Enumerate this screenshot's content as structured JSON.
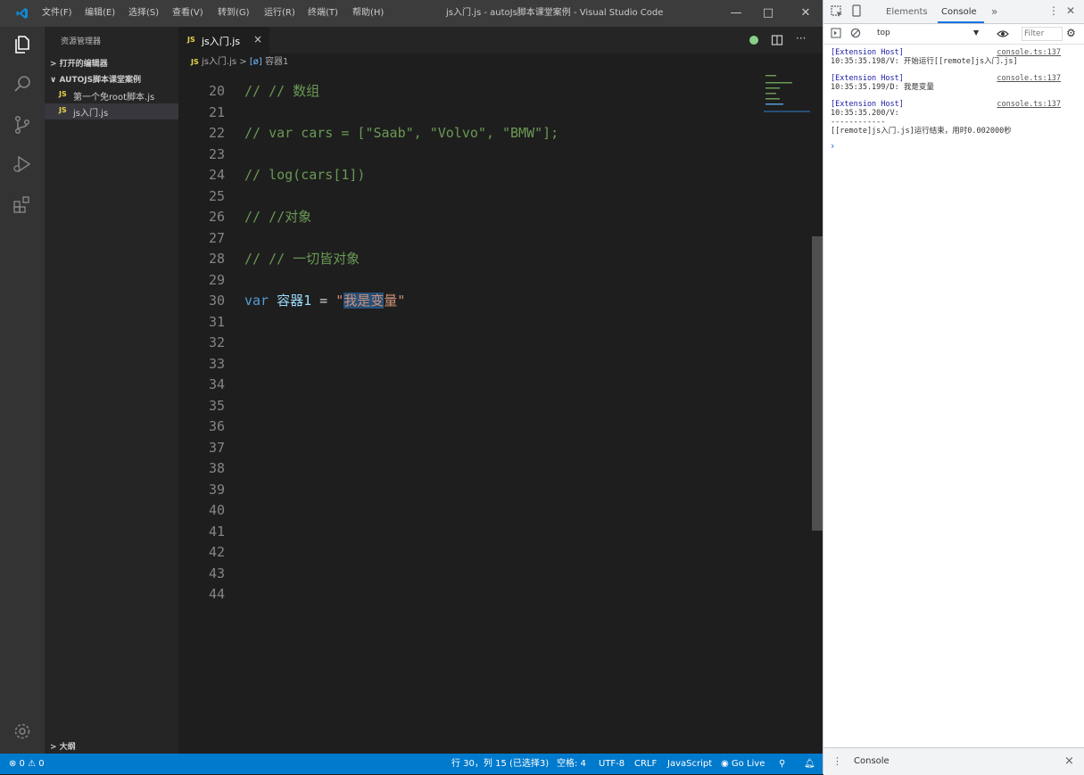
{
  "window": {
    "title": "js入门.js - autoJs脚本课堂案例 - Visual Studio Code",
    "menu": [
      "文件(F)",
      "编辑(E)",
      "选择(S)",
      "查看(V)",
      "转到(G)",
      "运行(R)",
      "终端(T)",
      "帮助(H)"
    ],
    "controls": {
      "minimize": "—",
      "maximize": "□",
      "close": "✕"
    }
  },
  "sidebar": {
    "title": "资源管理器",
    "open_editors": "> 打开的编辑器",
    "folder": "∨ AUTOJS脚本课堂案例",
    "files": [
      {
        "icon": "JS",
        "name": "第一个免root脚本.js"
      },
      {
        "icon": "JS",
        "name": "js入门.js"
      }
    ],
    "outline": "> 大纲"
  },
  "editor": {
    "tab": {
      "icon": "JS",
      "label": "js入门.js",
      "close": "×"
    },
    "breadcrumb": {
      "file_icon": "JS",
      "file": "js入门.js",
      "sep": ">",
      "symbol_icon": "[ø]",
      "symbol": "容器1"
    },
    "lines": [
      {
        "n": "20",
        "parts": [
          {
            "t": "// // 数组",
            "c": "cm"
          }
        ]
      },
      {
        "n": "21",
        "parts": []
      },
      {
        "n": "22",
        "parts": [
          {
            "t": "// var cars = [\"Saab\", \"Volvo\", \"BMW\"];",
            "c": "cm"
          }
        ]
      },
      {
        "n": "23",
        "parts": []
      },
      {
        "n": "24",
        "parts": [
          {
            "t": "// log(cars[1])",
            "c": "cm"
          }
        ]
      },
      {
        "n": "25",
        "parts": []
      },
      {
        "n": "26",
        "parts": [
          {
            "t": "// //对象",
            "c": "cm"
          }
        ]
      },
      {
        "n": "27",
        "parts": []
      },
      {
        "n": "28",
        "parts": [
          {
            "t": "// // 一切皆对象",
            "c": "cm"
          }
        ]
      },
      {
        "n": "29",
        "parts": []
      },
      {
        "n": "30",
        "parts": [
          {
            "t": "var ",
            "c": "kw"
          },
          {
            "t": "容器1",
            "c": "id"
          },
          {
            "t": " = ",
            "c": "op"
          },
          {
            "t": "\"",
            "c": "str"
          },
          {
            "t": "我是变",
            "c": "sel"
          },
          {
            "t": "量\"",
            "c": "str"
          }
        ]
      },
      {
        "n": "31",
        "parts": []
      },
      {
        "n": "32",
        "parts": []
      },
      {
        "n": "33",
        "parts": []
      },
      {
        "n": "34",
        "parts": []
      },
      {
        "n": "35",
        "parts": []
      },
      {
        "n": "36",
        "parts": []
      },
      {
        "n": "37",
        "parts": []
      },
      {
        "n": "38",
        "parts": []
      },
      {
        "n": "39",
        "parts": []
      },
      {
        "n": "40",
        "parts": []
      },
      {
        "n": "41",
        "parts": []
      },
      {
        "n": "42",
        "parts": []
      },
      {
        "n": "43",
        "parts": []
      },
      {
        "n": "44",
        "parts": []
      }
    ]
  },
  "statusbar": {
    "problems": "⊗ 0 ⚠ 0",
    "position": "行 30，列 15 (已选择3)",
    "spaces": "空格: 4",
    "encoding": "UTF-8",
    "eol": "CRLF",
    "language": "JavaScript",
    "golive": "Go Live"
  },
  "devtools": {
    "tabs": [
      "Elements",
      "Console"
    ],
    "active_tab": "Console",
    "more": "»",
    "context": "top",
    "filter_placeholder": "Filter",
    "logs": [
      {
        "source": "[Extension Host]",
        "link": "console.ts:137",
        "lines": [
          "10:35:35.198/V: 开始运行[[remote]js入门.js]"
        ]
      },
      {
        "source": "[Extension Host]",
        "link": "console.ts:137",
        "lines": [
          "10:35:35.199/D: 我是变量"
        ]
      },
      {
        "source": "[Extension Host]",
        "link": "console.ts:137",
        "lines": [
          "10:35:35.200/V:",
          "------------",
          "[[remote]js入门.js]运行结束，用时0.002000秒"
        ]
      }
    ],
    "prompt": "›",
    "drawer": {
      "label": "Console",
      "close": "×"
    }
  },
  "colors": {
    "status_bar": "#007acc",
    "selection": "#264f78",
    "comment": "#6a9955",
    "keyword": "#569cd6",
    "string": "#ce9178"
  }
}
